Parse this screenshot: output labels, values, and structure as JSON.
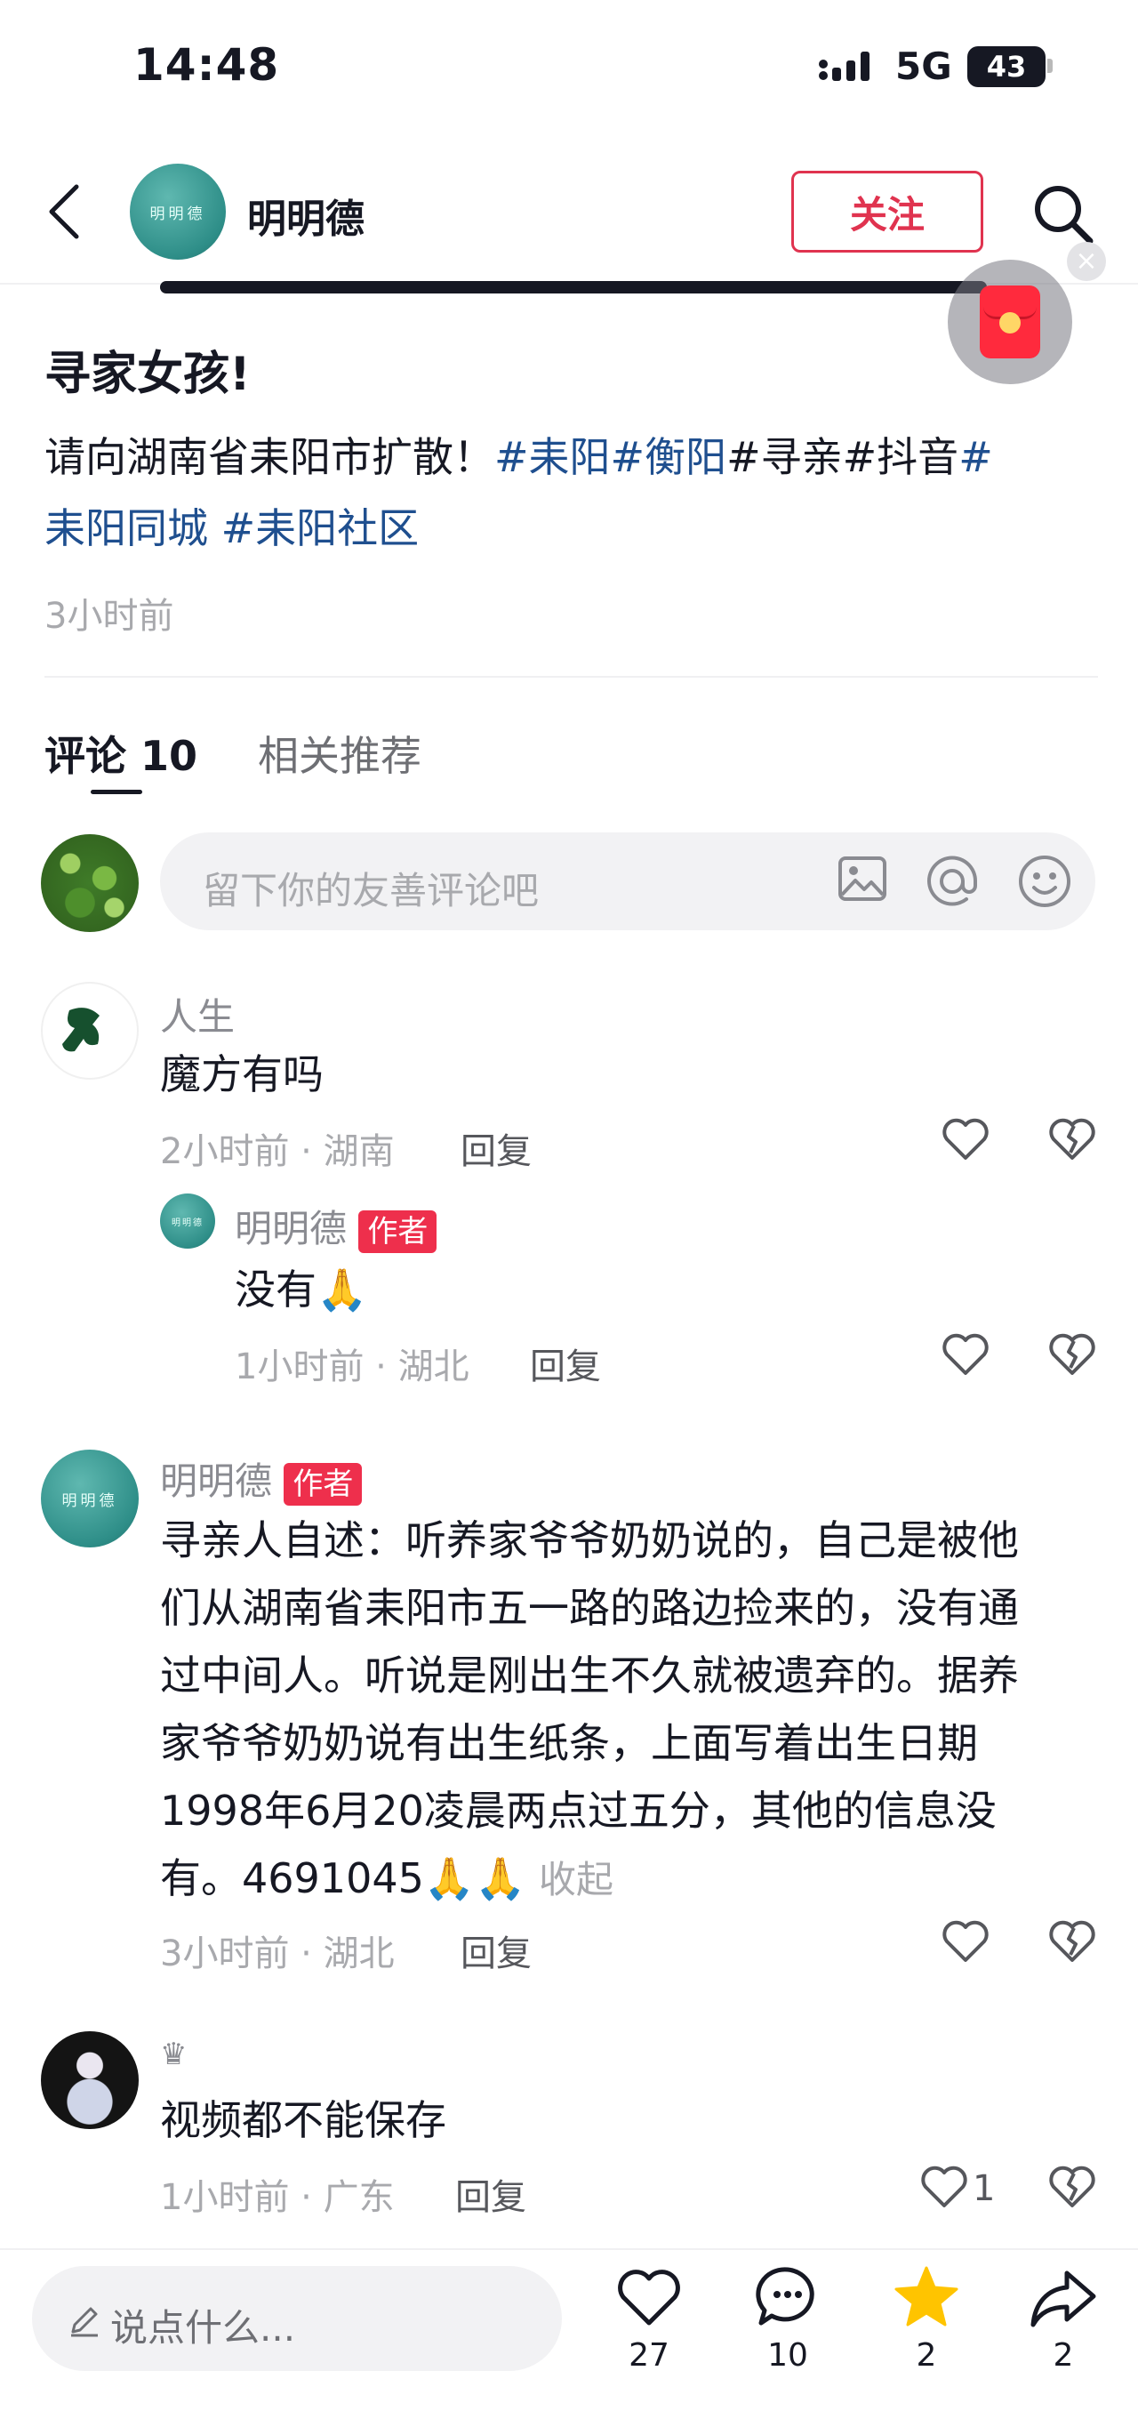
{
  "status_bar": {
    "time": "14:48",
    "network": "5G",
    "battery": "43"
  },
  "header": {
    "author": "明明德",
    "avatar_text": "明明德",
    "follow_label": "关注"
  },
  "post": {
    "title": "寻家女孩!",
    "body_prefix": "请向湖南省耒阳市扩散！",
    "tag_1": "#耒阳",
    "tag_2": "#衡阳",
    "tag_3_plain": "#寻亲#抖音",
    "tag_4": "#",
    "tag_5": "耒阳同城",
    "tag_6": "#耒阳社区",
    "time": "3小时前"
  },
  "tabs": {
    "comments_label": "评论",
    "comments_count": "10",
    "related_label": "相关推荐"
  },
  "comment_input": {
    "placeholder": "留下你的友善评论吧"
  },
  "comments": [
    {
      "name": "人生",
      "text": "魔方有吗",
      "meta": "2小时前 · 湖南",
      "reply": "回复"
    },
    {
      "name": "明明德",
      "badge": "作者",
      "text": "没有🙏",
      "meta": "1小时前 · 湖北",
      "reply": "回复"
    },
    {
      "name": "明明德",
      "badge": "作者",
      "lines": [
        "寻亲人自述：听养家爷爷奶奶说的，自己是被他",
        "们从湖南省耒阳市五一路的路边捡来的，没有通",
        "过中间人。听说是刚出生不久就被遗弃的。据养",
        "家爷爷奶奶说有出生纸条，上面写着出生日期",
        "1998年6月20凌晨两点过五分，其他的信息没",
        "有。4691045🙏🙏"
      ],
      "collapse": "收起",
      "meta": "3小时前 · 湖北",
      "reply": "回复"
    },
    {
      "name": "♛",
      "text": "视频都不能保存",
      "meta": "1小时前 · 广东",
      "reply": "回复",
      "likes": "1"
    }
  ],
  "bottom_bar": {
    "say_placeholder": "说点什么...",
    "likes": "27",
    "comments": "10",
    "favorites": "2",
    "shares": "2"
  },
  "colors": {
    "accent": "#e0334f",
    "hashtag": "#1f4f8f",
    "star": "#ffc400",
    "badge": "#ee2f4c"
  }
}
